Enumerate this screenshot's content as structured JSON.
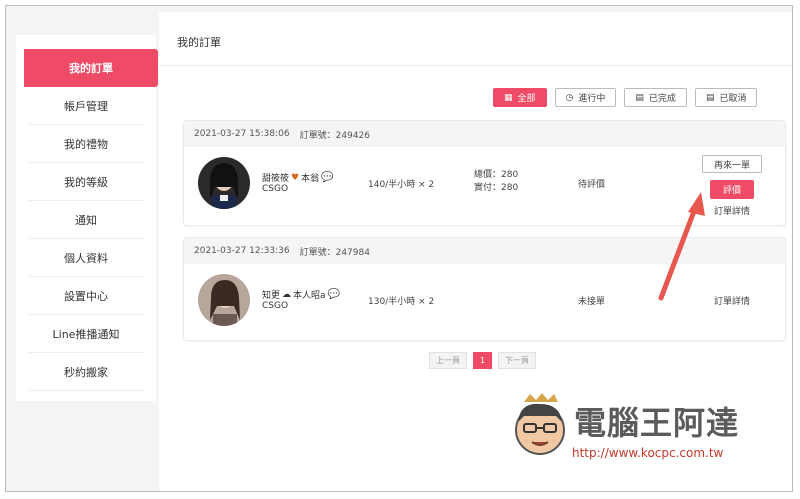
{
  "sidebar": {
    "items": [
      {
        "label": "我的訂單",
        "active": true
      },
      {
        "label": "帳戶管理"
      },
      {
        "label": "我的禮物"
      },
      {
        "label": "我的等級"
      },
      {
        "label": "通知"
      },
      {
        "label": "個人資料"
      },
      {
        "label": "設置中心"
      },
      {
        "label": "Line推播通知"
      },
      {
        "label": "秒約搬家"
      }
    ]
  },
  "main": {
    "title": "我的訂單",
    "filters": [
      {
        "label": "全部",
        "icon": "list-icon",
        "active": true
      },
      {
        "label": "進行中",
        "icon": "clock-icon"
      },
      {
        "label": "已完成",
        "icon": "doc-icon"
      },
      {
        "label": "已取消",
        "icon": "doc-icon"
      }
    ],
    "orders": [
      {
        "datetime": "2021-03-27 15:38:06",
        "order_no": "訂單號：249426",
        "name_a": "甜筱筱",
        "name_b": "本翁",
        "game": "CSGO",
        "price": "140/半小時 × 2",
        "total": "總價：280",
        "paid": "實付：280",
        "status": "待評價",
        "again": "再來一單",
        "review": "評價",
        "detail": "訂單詳情"
      },
      {
        "datetime": "2021-03-27 12:33:36",
        "order_no": "訂單號：247984",
        "name_a": "知更",
        "name_b": "本人昭a",
        "game": "CSGO",
        "price": "130/半小時 × 2",
        "status": "未接單",
        "detail": "訂單詳情"
      }
    ],
    "pager": {
      "prev": "上一頁",
      "current": "1",
      "next": "下一頁"
    }
  },
  "watermark": {
    "title": "電腦王阿達",
    "url": "http://www.kocpc.com.tw"
  },
  "colors": {
    "accent": "#ef4b67",
    "arrow": "#e8574f"
  }
}
